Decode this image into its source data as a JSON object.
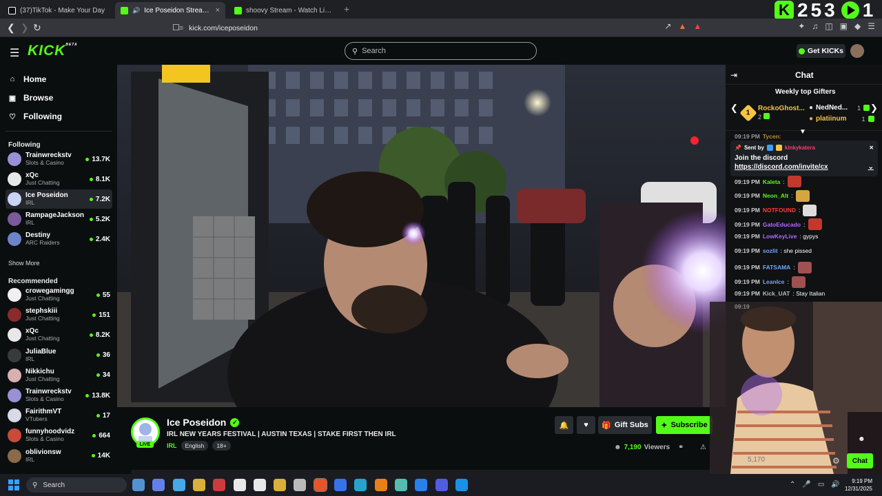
{
  "browser": {
    "tabs": [
      {
        "title": "(37)TikTok - Make Your Day",
        "icon_color": "#ffffff",
        "active": false
      },
      {
        "title": "Ice Poseidon Stream - Watch",
        "icon_color": "#53fc18",
        "active": true,
        "audio": "🔊"
      },
      {
        "title": "shoovy Stream - Watch Live on Kick",
        "icon_color": "#53fc18",
        "active": false
      }
    ],
    "close_glyph": "×",
    "new_tab_glyph": "+",
    "url": "kick.com/iceposeidon",
    "kick_counter": {
      "logo": "K",
      "count": "253",
      "suffix": "1"
    }
  },
  "header": {
    "logo": "KICK",
    "logo_badge": "BETA",
    "search_placeholder": "Search",
    "get_kicks_label": "Get KICKs"
  },
  "sidebar": {
    "nav": [
      {
        "label": "Home",
        "icon": "home-icon",
        "glyph": "⌂"
      },
      {
        "label": "Browse",
        "icon": "browse-icon",
        "glyph": "▣"
      },
      {
        "label": "Following",
        "icon": "heart-icon",
        "glyph": "♡"
      }
    ],
    "following_header": "Following",
    "following": [
      {
        "name": "Trainwreckstv",
        "category": "Slots & Casino",
        "viewers": "13.7K",
        "color": "#9b8fd6"
      },
      {
        "name": "xQc",
        "category": "Just Chatting",
        "viewers": "8.1K",
        "color": "#e8e8e8"
      },
      {
        "name": "Ice Poseidon",
        "category": "IRL",
        "viewers": "7.2K",
        "color": "#c9d3f5",
        "selected": true
      },
      {
        "name": "RampageJackson",
        "category": "IRL",
        "viewers": "5.2K",
        "color": "#7a5a9a"
      },
      {
        "name": "Destiny",
        "category": "ARC Raiders",
        "viewers": "2.4K",
        "color": "#6d84c9"
      }
    ],
    "show_more": "Show More",
    "recommended_header": "Recommended",
    "recommended": [
      {
        "name": "crowegamingg",
        "category": "Just Chatting",
        "viewers": "55",
        "color": "#f0f0f0"
      },
      {
        "name": "stephskiii",
        "category": "Just Chatting",
        "viewers": "151",
        "color": "#8a2a2a"
      },
      {
        "name": "xQc",
        "category": "Just Chatting",
        "viewers": "8.2K",
        "color": "#e8e8e8"
      },
      {
        "name": "JuliaBlue",
        "category": "IRL",
        "viewers": "36",
        "color": "#3a3a3a"
      },
      {
        "name": "Nikkichu",
        "category": "Just Chatting",
        "viewers": "34",
        "color": "#d9b0b0"
      },
      {
        "name": "Trainwreckstv",
        "category": "Slots & Casino",
        "viewers": "13.8K",
        "color": "#9b8fd6"
      },
      {
        "name": "FairithmVT",
        "category": "VTubers",
        "viewers": "17",
        "color": "#d9d9e8"
      },
      {
        "name": "funnyhoodvidz",
        "category": "Slots & Casino",
        "viewers": "664",
        "color": "#c94a3a"
      },
      {
        "name": "oblivionsw",
        "category": "IRL",
        "viewers": "14K",
        "color": "#8a6a4a"
      }
    ]
  },
  "stream": {
    "name": "Ice Poseidon",
    "title": "IRL NEW YEARS FESTIVAL | AUSTIN TEXAS | STAKE FIRST THEN IRL",
    "category": "IRL",
    "tags": [
      "English",
      "18+"
    ],
    "live_badge": "LIVE",
    "viewers": "7,190",
    "viewers_label": "Viewers",
    "gift_subs_label": "Gift Subs",
    "subscribe_label": "Subscribe"
  },
  "chat": {
    "title": "Chat",
    "weekly_header": "Weekly top Gifters",
    "gifters": [
      {
        "rank": "1",
        "name": "RockoGhost...",
        "count": "2"
      },
      {
        "name": "NedNed...",
        "count": "1"
      },
      {
        "name": "platiinum",
        "count": "1"
      }
    ],
    "partial_top": "09:19 PM",
    "partial_top_user": "Tycen:",
    "pinned": {
      "sent_by": "Sent by",
      "sender": "kinkykatera",
      "text": "Join the discord",
      "link": "https://discord.com/invite/cx"
    },
    "messages": [
      {
        "time": "09:19 PM",
        "user": "Kaleta",
        "color": "#53fc18",
        "text": ":",
        "emote": "#c0392b"
      },
      {
        "time": "09:19 PM",
        "user": "Neon_Alt",
        "color": "#53fc18",
        "text": ":",
        "emote": "#d4a640"
      },
      {
        "time": "09:19 PM",
        "user": "NOTFOUND",
        "color": "#ff3b3b",
        "text": ":",
        "emote": "#dddddd"
      },
      {
        "time": "09:19 PM",
        "user": "GatoEducado",
        "color": "#b36bff",
        "text": ":",
        "emote": "#c0392b"
      },
      {
        "time": "09:19 PM",
        "user": "LowKeyLive",
        "color": "#b36bff",
        "text": ": gypys",
        "emote": ""
      },
      {
        "time": "09:19 PM",
        "user": "sozlit",
        "color": "#6fa8ff",
        "text": ": she pissed",
        "emote": ""
      },
      {
        "time": "09:19 PM",
        "user": "FATSAMA",
        "color": "#6fa8ff",
        "text": ":",
        "emote": "#a05050"
      },
      {
        "time": "09:19 PM",
        "user": "LeanIce",
        "color": "#6fa8ff",
        "text": ":",
        "emote": "#a05050"
      },
      {
        "time": "09:19 PM",
        "user": "Kick_UAT",
        "color": "#bbbbbb",
        "text": ": Stay Italian",
        "emote": ""
      }
    ],
    "partial_bottom": "09:19",
    "send_label": "Chat",
    "dim_count": "5,170"
  },
  "taskbar": {
    "search_label": "Search",
    "time": "9:19 PM",
    "date": "12/31/2025",
    "apps": [
      "#5aa0e6",
      "#6a8cff",
      "#4db8ff",
      "#f0c040",
      "#e04040",
      "#ffffff",
      "#ffffff",
      "#f0c040",
      "#cccccc",
      "#ff5b2b",
      "#3a7dff",
      "#2ab0e0",
      "#ff8c1a",
      "#5ad0c0",
      "#2a8cff",
      "#5865f2",
      "#1a9fff"
    ]
  }
}
